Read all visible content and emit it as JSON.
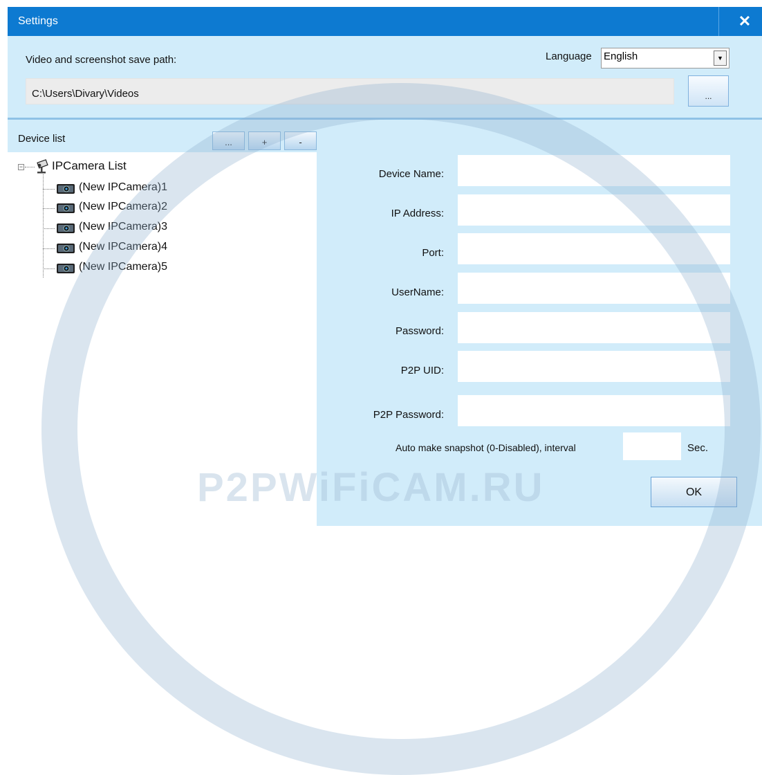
{
  "window": {
    "title": "Settings",
    "close_glyph": "✕"
  },
  "save_path": {
    "label": "Video and screenshot save path:",
    "value": "C:\\Users\\Divary\\Videos",
    "browse_label": "..."
  },
  "language": {
    "label": "Language",
    "selected": "English",
    "arrow": "▼"
  },
  "device_list": {
    "label": "Device list",
    "buttons": [
      "...",
      "+",
      "-"
    ],
    "root": "IPCamera List",
    "items": [
      "(New IPCamera)1",
      "(New IPCamera)2",
      "(New IPCamera)3",
      "(New IPCamera)4",
      "(New IPCamera)5"
    ]
  },
  "form": {
    "device_name": "Device Name:",
    "ip_address": "IP Address:",
    "port": "Port:",
    "username": "UserName:",
    "password": "Password:",
    "p2p_uid": "P2P UID:",
    "p2p_password": "P2P Password:"
  },
  "snapshot": {
    "label": "Auto make snapshot (0-Disabled), interval",
    "unit": "Sec."
  },
  "ok_label": "OK",
  "watermark": "P2PWiFiCAM.RU",
  "colors": {
    "titlebar": "#0d7ad1",
    "window_bg": "#d1ecfa"
  },
  "icons": {
    "root": "camera-list-icon",
    "item": "ip-camera-icon"
  }
}
